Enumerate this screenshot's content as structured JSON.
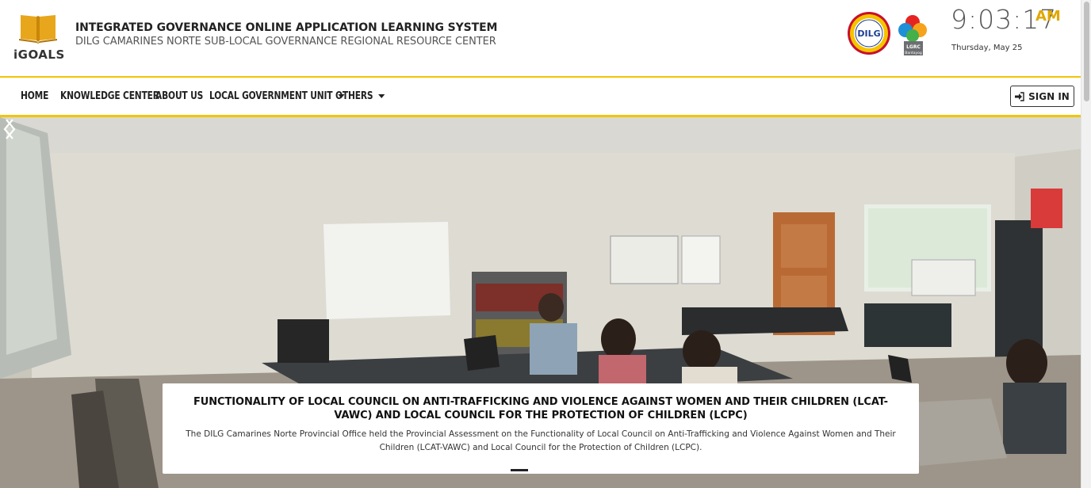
{
  "header": {
    "logo_text": "iGOALS",
    "title": "INTEGRATED GOVERNANCE ONLINE APPLICATION LEARNING SYSTEM",
    "subtitle": "DILG CAMARINES NORTE SUB-LOCAL GOVERNANCE REGIONAL RESOURCE CENTER",
    "seal_text": "DILG",
    "lgrc_text": "LGRC",
    "lgrc_subtext": "Bantayog",
    "clock_time": "9:03:17",
    "clock_ampm": "AM",
    "clock_date": "Thursday, May 25"
  },
  "nav": {
    "items": [
      {
        "label": "HOME"
      },
      {
        "label": "KNOWLEDGE CENTER"
      },
      {
        "label": "ABOUT US"
      },
      {
        "label": "LOCAL GOVERNMENT UNIT"
      },
      {
        "label": "OTHERS"
      }
    ],
    "signin_label": "SIGN IN"
  },
  "hero": {
    "caption_title": "FUNCTIONALITY OF LOCAL COUNCIL ON ANTI-TRAFFICKING AND VIOLENCE AGAINST WOMEN AND THEIR CHILDREN (LCAT-VAWC) AND LOCAL COUNCIL FOR THE PROTECTION OF CHILDREN (LCPC)",
    "caption_text": "The DILG Camarines Norte Provincial Office held the Provincial Assessment on the Functionality of Local Council on Anti-Trafficking and Violence Against Women and Their Children (LCAT-VAWC) and Local Council for the Protection of Children (LCPC).",
    "slide_count": 3,
    "active_slide": 1
  },
  "colors": {
    "accent": "#f2c500",
    "ampm": "#e0a800"
  }
}
